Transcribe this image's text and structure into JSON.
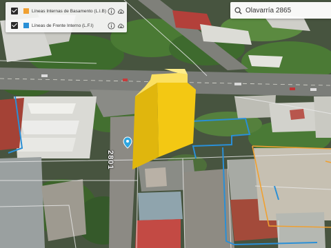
{
  "layers": [
    {
      "label": "Líneas Internas de Basamento (L.I.B)",
      "color": "#f0a030",
      "checked": true,
      "info_icon": "info-icon",
      "download_icon": "cloud-download-icon"
    },
    {
      "label": "Líneas de Frente Interno (L.F.I)",
      "color": "#2a8fd6",
      "checked": true,
      "info_icon": "info-icon",
      "download_icon": "cloud-download-icon"
    }
  ],
  "search": {
    "value": "Olavarría 2865",
    "icon": "search-icon"
  },
  "map": {
    "street_number": "2801",
    "building_color": "#f3c813",
    "lib_line_color": "#f0a030",
    "lfi_line_color": "#2a8fd6",
    "location_pin_icon": "location-pin-icon"
  }
}
